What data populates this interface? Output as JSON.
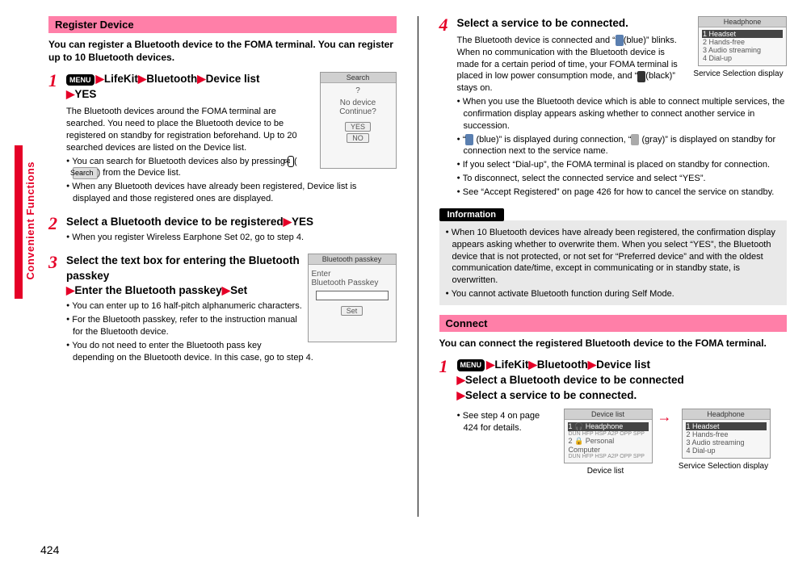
{
  "side_label": "Convenient Functions",
  "page_number": "424",
  "left": {
    "section_title": "Register Device",
    "intro": "You can register a Bluetooth device to the FOMA terminal. You can register up to 10 Bluetooth devices.",
    "step1": {
      "num": "1",
      "menu": "MENU",
      "p1": "LifeKit",
      "p2": "Bluetooth",
      "p3": "Device list",
      "p4": "YES",
      "body": "The Bluetooth devices around the FOMA terminal are searched. You need to place the Bluetooth device to be registered on standby for registration beforehand. Up to 20 searched devices are listed on the Device list.",
      "b1a": "You can search for Bluetooth devices also by pressing ",
      "b1_soft": "✉",
      "b1_gray": "Search",
      "b1b": " from the Device list.",
      "b2": "When any Bluetooth devices have already been registered, Device list is displayed and those registered ones are displayed.",
      "shot_title": "Search",
      "shot_line1": "?",
      "shot_line2": "No device",
      "shot_line3": "Continue?",
      "shot_yes": "YES",
      "shot_no": "NO"
    },
    "step2": {
      "num": "2",
      "title_a": "Select a Bluetooth device to be registered",
      "title_b": "YES",
      "b1": "When you register Wireless Earphone Set 02, go to step 4."
    },
    "step3": {
      "num": "3",
      "title_a": "Select the text box for entering the Bluetooth passkey",
      "title_b": "Enter the Bluetooth passkey",
      "title_c": "Set",
      "b1": "You can enter up to 16 half-pitch alphanumeric characters.",
      "b2": "For the Bluetooth passkey, refer to the instruction manual for the Bluetooth device.",
      "b3": "You do not need to enter the Bluetooth pass key depending on the Bluetooth device. In this case, go to step 4.",
      "shot_title": "Bluetooth passkey",
      "shot_line1": "Enter",
      "shot_line2": "Bluetooth Passkey",
      "shot_btn": "Set"
    }
  },
  "right": {
    "step4": {
      "num": "4",
      "title": "Select a service to be connected.",
      "body_a": "The Bluetooth device is connected and “",
      "body_b": "(blue)” blinks. When no communication with the Bluetooth device is made for a certain period of time, your FOMA terminal is placed in low power consumption mode, and “",
      "body_c": "(black)” stays on.",
      "b1": "When you use the Bluetooth device which is able to connect multiple services, the confirmation display appears asking whether to connect another service in succession.",
      "b2a": "“",
      "b2b": " (blue)” is displayed during connection, “",
      "b2c": " (gray)” is displayed on standby for connection next to the service name.",
      "b3": "If you select “Dial-up”, the FOMA terminal is placed on standby for connection.",
      "b4": "To disconnect, select the connected service and select “YES”.",
      "b5": "See “Accept Registered” on page 426 for how to cancel the service on standby.",
      "shot_title": "Headphone",
      "shot_r1": "Headset",
      "shot_r2": "Hands-free",
      "shot_r3": "Audio streaming",
      "shot_r4": "Dial-up",
      "shot_caption": "Service Selection display"
    },
    "info": {
      "label": "Information",
      "b1": "When 10 Bluetooth devices have already been registered, the confirmation display appears asking whether to overwrite them. When you select “YES”, the Bluetooth device that is not protected, or not set for “Preferred device” and with the oldest communication date/time, except in communicating or in standby state, is overwritten.",
      "b2": "You cannot activate Bluetooth function during Self Mode."
    },
    "connect": {
      "section_title": "Connect",
      "intro": "You can connect the registered Bluetooth device to the FOMA terminal.",
      "step1": {
        "num": "1",
        "menu": "MENU",
        "p1": "LifeKit",
        "p2": "Bluetooth",
        "p3": "Device list",
        "line2": "Select a Bluetooth device to be connected",
        "line3": "Select a service to be connected."
      },
      "b1": "See step 4 on page 424 for details.",
      "shot1_title": "Device list",
      "shot1_r1": "Headphone",
      "shot1_r2": "Personal Computer",
      "shot1_caption": "Device list",
      "shot2_title": "Headphone",
      "shot2_r1": "Headset",
      "shot2_r2": "Hands-free",
      "shot2_r3": "Audio streaming",
      "shot2_r4": "Dial-up",
      "shot2_caption": "Service Selection display"
    }
  }
}
